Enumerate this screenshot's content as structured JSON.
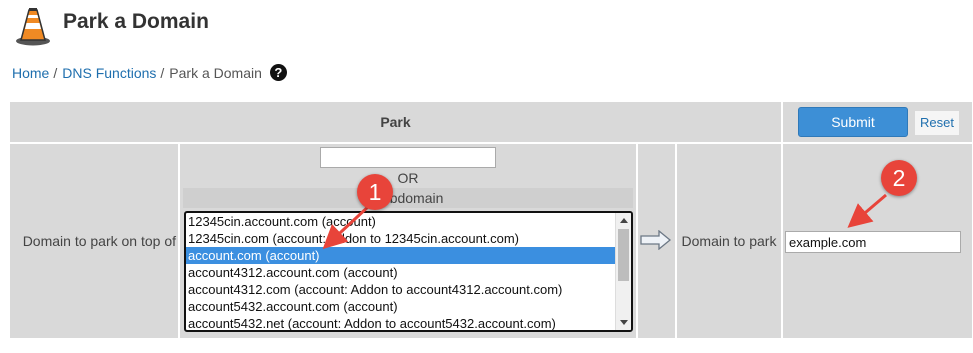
{
  "header": {
    "title": "Park a Domain",
    "logo_icon": "traffic-cone-icon"
  },
  "breadcrumb": {
    "items": [
      "Home",
      "DNS Functions",
      "Park a Domain"
    ],
    "separator": "/",
    "help_icon": "question-circle-icon"
  },
  "form": {
    "park_header": "Park",
    "submit_label": "Submit",
    "reset_label": "Reset",
    "left_label": "Domain to park on top of",
    "or_label": "OR",
    "subdomain_header": "Subdomain",
    "right_label": "Domain to park",
    "domain_value": "example.com",
    "domain_list": [
      "12345cin.account.com (account)",
      "12345cin.com (account: Addon to 12345cin.account.com)",
      "account.com (account)",
      "account4312.account.com (account)",
      "account4312.com (account: Addon to account4312.account.com)",
      "account5432.account.com (account)",
      "account5432.net (account: Addon to account5432.account.com)"
    ],
    "selected_index": 2,
    "arrow_icon": "right-arrow-icon"
  },
  "callouts": [
    "1",
    "2"
  ],
  "colors": {
    "accent": "#3d8fd6",
    "selected": "#3b8fe0",
    "callout": "#e8443a",
    "cell_bg": "#d9d9d9",
    "link": "#1f6fae"
  }
}
